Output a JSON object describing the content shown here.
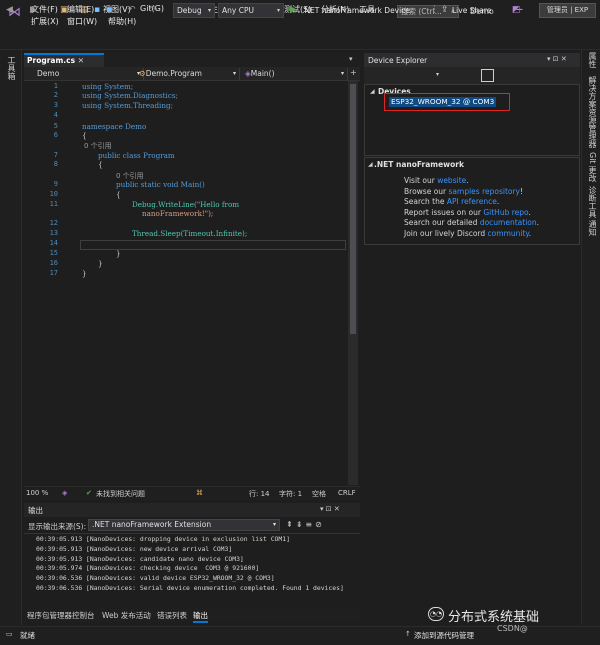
{
  "menu": {
    "row1": [
      "文件(F)",
      "编辑(E)",
      "视图(V)",
      "Git(G)",
      "项目(P)",
      "生成(B)",
      "调试(D)",
      "测试(S)",
      "分析(N)",
      "工具"
    ],
    "row2": [
      "扩展(X)",
      "窗口(W)",
      "帮助(H)"
    ],
    "search_placeholder": "搜索 (Ctrl...",
    "app_title": "Demo"
  },
  "toolbar": {
    "config": "Debug",
    "platform": "Any CPU",
    "run_target": ".NET nanoFramework Device",
    "live_share": "Live Share",
    "admin": "管理员 | EXP"
  },
  "left_rail": {
    "label": "工具箱"
  },
  "right_rail": {
    "labels": [
      "属性",
      "解决方案资源管理器",
      "Git 更改",
      "诊断工具",
      "通知"
    ]
  },
  "editor": {
    "tab": "Program.cs",
    "nav": [
      "Demo",
      "Demo.Program",
      "Main()"
    ],
    "lines": [
      {
        "n": "1",
        "text": "using System;"
      },
      {
        "n": "2",
        "text": "using System.Diagnostics;"
      },
      {
        "n": "3",
        "text": "using System.Threading;"
      },
      {
        "n": "4",
        "text": ""
      },
      {
        "n": "5",
        "text": "namespace Demo"
      },
      {
        "n": "6",
        "text": "{"
      },
      {
        "n": "",
        "text": "0 个引用"
      },
      {
        "n": "7",
        "text": "public class Program"
      },
      {
        "n": "8",
        "text": "{"
      },
      {
        "n": "",
        "text": "0 个引用"
      },
      {
        "n": "9",
        "text": "public static void Main()"
      },
      {
        "n": "10",
        "text": "{"
      },
      {
        "n": "11",
        "text": "Debug.WriteLine(\"Hello from"
      },
      {
        "n": "",
        "text": "nanoFramework!\");"
      },
      {
        "n": "12",
        "text": ""
      },
      {
        "n": "13",
        "text": "Thread.Sleep(Timeout.Infinite);"
      },
      {
        "n": "14",
        "text": ""
      },
      {
        "n": "15",
        "text": "}"
      },
      {
        "n": "16",
        "text": "}"
      },
      {
        "n": "17",
        "text": "}"
      }
    ],
    "status": {
      "zoom": "100 %",
      "issues": "未找到相关问题",
      "line": "行: 14",
      "col": "字符: 1",
      "space": "空格",
      "eol": "CRLF"
    }
  },
  "output": {
    "title": "输出",
    "source_label": "显示输出来源(S):",
    "source_value": ".NET nanoFramework Extension",
    "lines": [
      "00:39:05.913 [NanoDevices: dropping device in exclusion list COM1]",
      "00:39:05.913 [NanoDevices: new device arrival COM3]",
      "00:39:05.913 [NanoDevices: candidate nano device COM3]",
      "00:39:05.974 [NanoDevices: checking device  COM3 @ 921600]",
      "00:39:06.536 [NanoDevices: valid device ESP32_WROOM_32 @ COM3]",
      "00:39:06.536 [NanoDevices: Serial device enumeration completed. Found 1 devices]"
    ],
    "tabs": [
      "程序包管理器控制台",
      "Web 发布活动",
      "错误列表",
      "输出"
    ]
  },
  "device_explorer": {
    "title": "Device Explorer",
    "devices_label": "Devices",
    "device": "ESP32_WROOM_32 @ COM3",
    "nf_title": ".NET nanoFramework",
    "links": [
      {
        "pre": "Visit our ",
        "link": "website",
        "post": "."
      },
      {
        "pre": "Browse our ",
        "link": "samples repository",
        "post": "!"
      },
      {
        "pre": "Search the ",
        "link": "API reference",
        "post": "."
      },
      {
        "pre": "Report issues on our ",
        "link": "GitHub repo",
        "post": "."
      },
      {
        "pre": "Search our detailed ",
        "link": "documentation",
        "post": "."
      },
      {
        "pre": "Join our lively Discord ",
        "link": "community",
        "post": "."
      }
    ]
  },
  "statusbar": {
    "ready": "就绪",
    "source_control": "添加到源代码管理"
  },
  "watermark": {
    "main": "分布式系统基础",
    "sub": "CSDN@"
  }
}
